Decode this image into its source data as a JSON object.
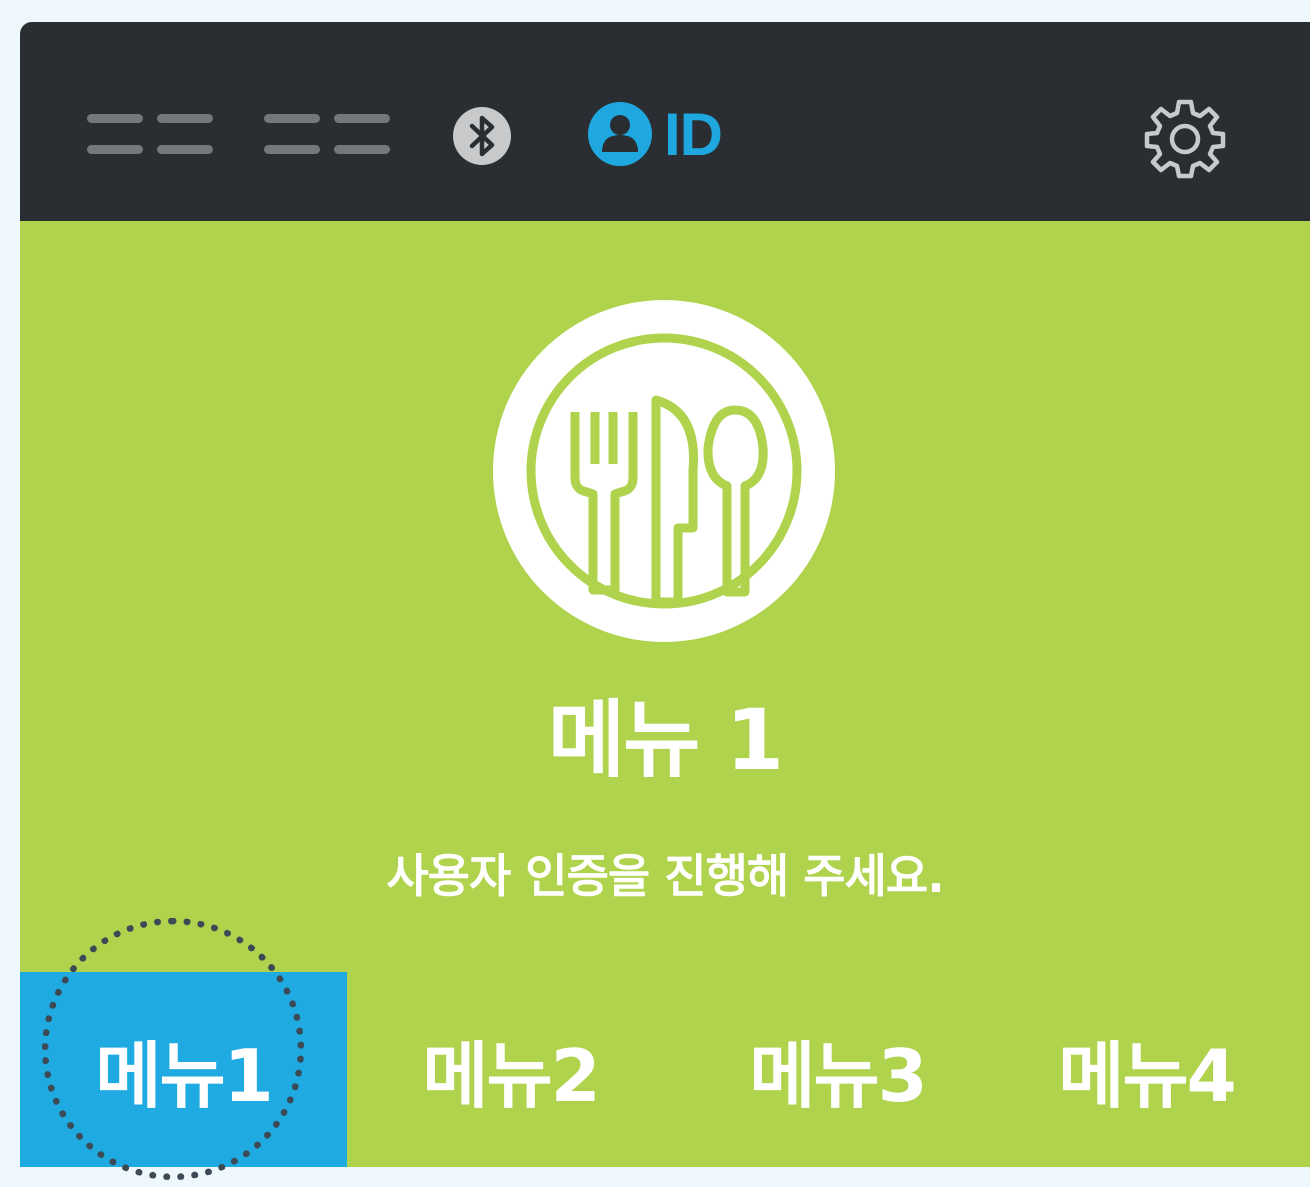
{
  "status_bar": {
    "bluetooth_icon": "bluetooth-icon",
    "user_icon": "user-icon",
    "id_label": "ID",
    "settings_icon": "gear-icon",
    "accent_color": "#1fa8df"
  },
  "main": {
    "icon": "utensils-icon",
    "title": "메뉴 1",
    "subtitle": "사용자 인증을 진행해 주세요.",
    "background_color": "#b0d34d"
  },
  "tabs": [
    {
      "label": "메뉴1",
      "active": true
    },
    {
      "label": "메뉴2",
      "active": false
    },
    {
      "label": "메뉴3",
      "active": false
    },
    {
      "label": "메뉴4",
      "active": false
    }
  ]
}
